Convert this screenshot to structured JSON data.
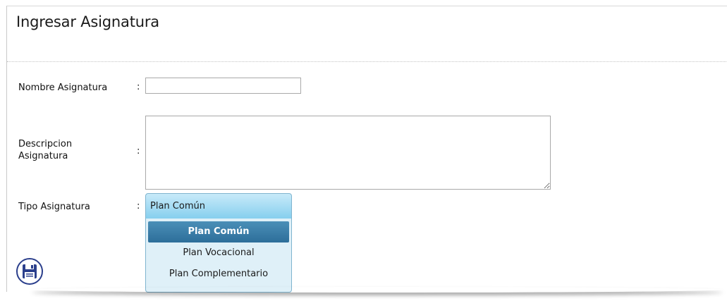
{
  "page": {
    "title": "Ingresar Asignatura"
  },
  "form": {
    "nombre": {
      "label": "Nombre Asignatura",
      "colon": ":",
      "value": ""
    },
    "descripcion": {
      "label_line1": "Descripcion",
      "label_line2": "Asignatura",
      "colon": ":",
      "value": ""
    },
    "tipo": {
      "label": "Tipo Asignatura",
      "colon": ":",
      "selected": "Plan Común",
      "options": [
        "Plan Común",
        "Plan Vocacional",
        "Plan Complementario"
      ]
    }
  },
  "actions": {
    "save_icon": "floppy-disk-icon"
  },
  "colors": {
    "select_gradient_top": "#c8eaf9",
    "select_gradient_bottom": "#86cfee",
    "option_selected": "#2d6e9a",
    "dropdown_bg": "#dff0f8",
    "save_icon": "#2b3f8c"
  }
}
